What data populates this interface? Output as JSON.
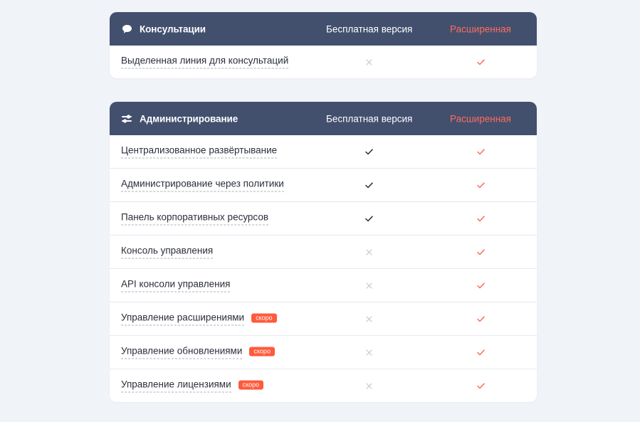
{
  "colors": {
    "background": "#f0f3f8",
    "header": "#42506e",
    "accent": "#ff6b5c",
    "badge": "#ff5a3c",
    "check_dark": "#2b2f3b",
    "cross_gray": "#c4c8d0"
  },
  "columns": {
    "free": "Бесплатная версия",
    "extended": "Расширенная"
  },
  "consultations": {
    "icon": "speech-bubble-icon",
    "title": "Консультации",
    "free_label": "Бесплатная версия",
    "extended_label": "Расширенная",
    "rows": [
      {
        "label": "Выделенная линия для консультаций",
        "free": "cross",
        "extended": "check"
      }
    ]
  },
  "administration": {
    "icon": "sliders-icon",
    "title": "Администрирование",
    "free_label": "Бесплатная версия",
    "extended_label": "Расширенная",
    "rows": [
      {
        "label": "Централизованное развёртывание",
        "free": "check",
        "extended": "check"
      },
      {
        "label": "Администрирование через политики",
        "free": "check",
        "extended": "check"
      },
      {
        "label": "Панель корпоративных ресурсов",
        "free": "check",
        "extended": "check"
      },
      {
        "label": "Консоль управления",
        "free": "cross",
        "extended": "check"
      },
      {
        "label": "API консоли управления",
        "free": "cross",
        "extended": "check"
      },
      {
        "label": "Управление расширениями",
        "badge": "скоро",
        "free": "cross",
        "extended": "check"
      },
      {
        "label": "Управление обновлениями",
        "badge": "скоро",
        "free": "cross",
        "extended": "check"
      },
      {
        "label": "Управление лицензиями",
        "badge": "скоро",
        "free": "cross",
        "extended": "check"
      }
    ]
  }
}
